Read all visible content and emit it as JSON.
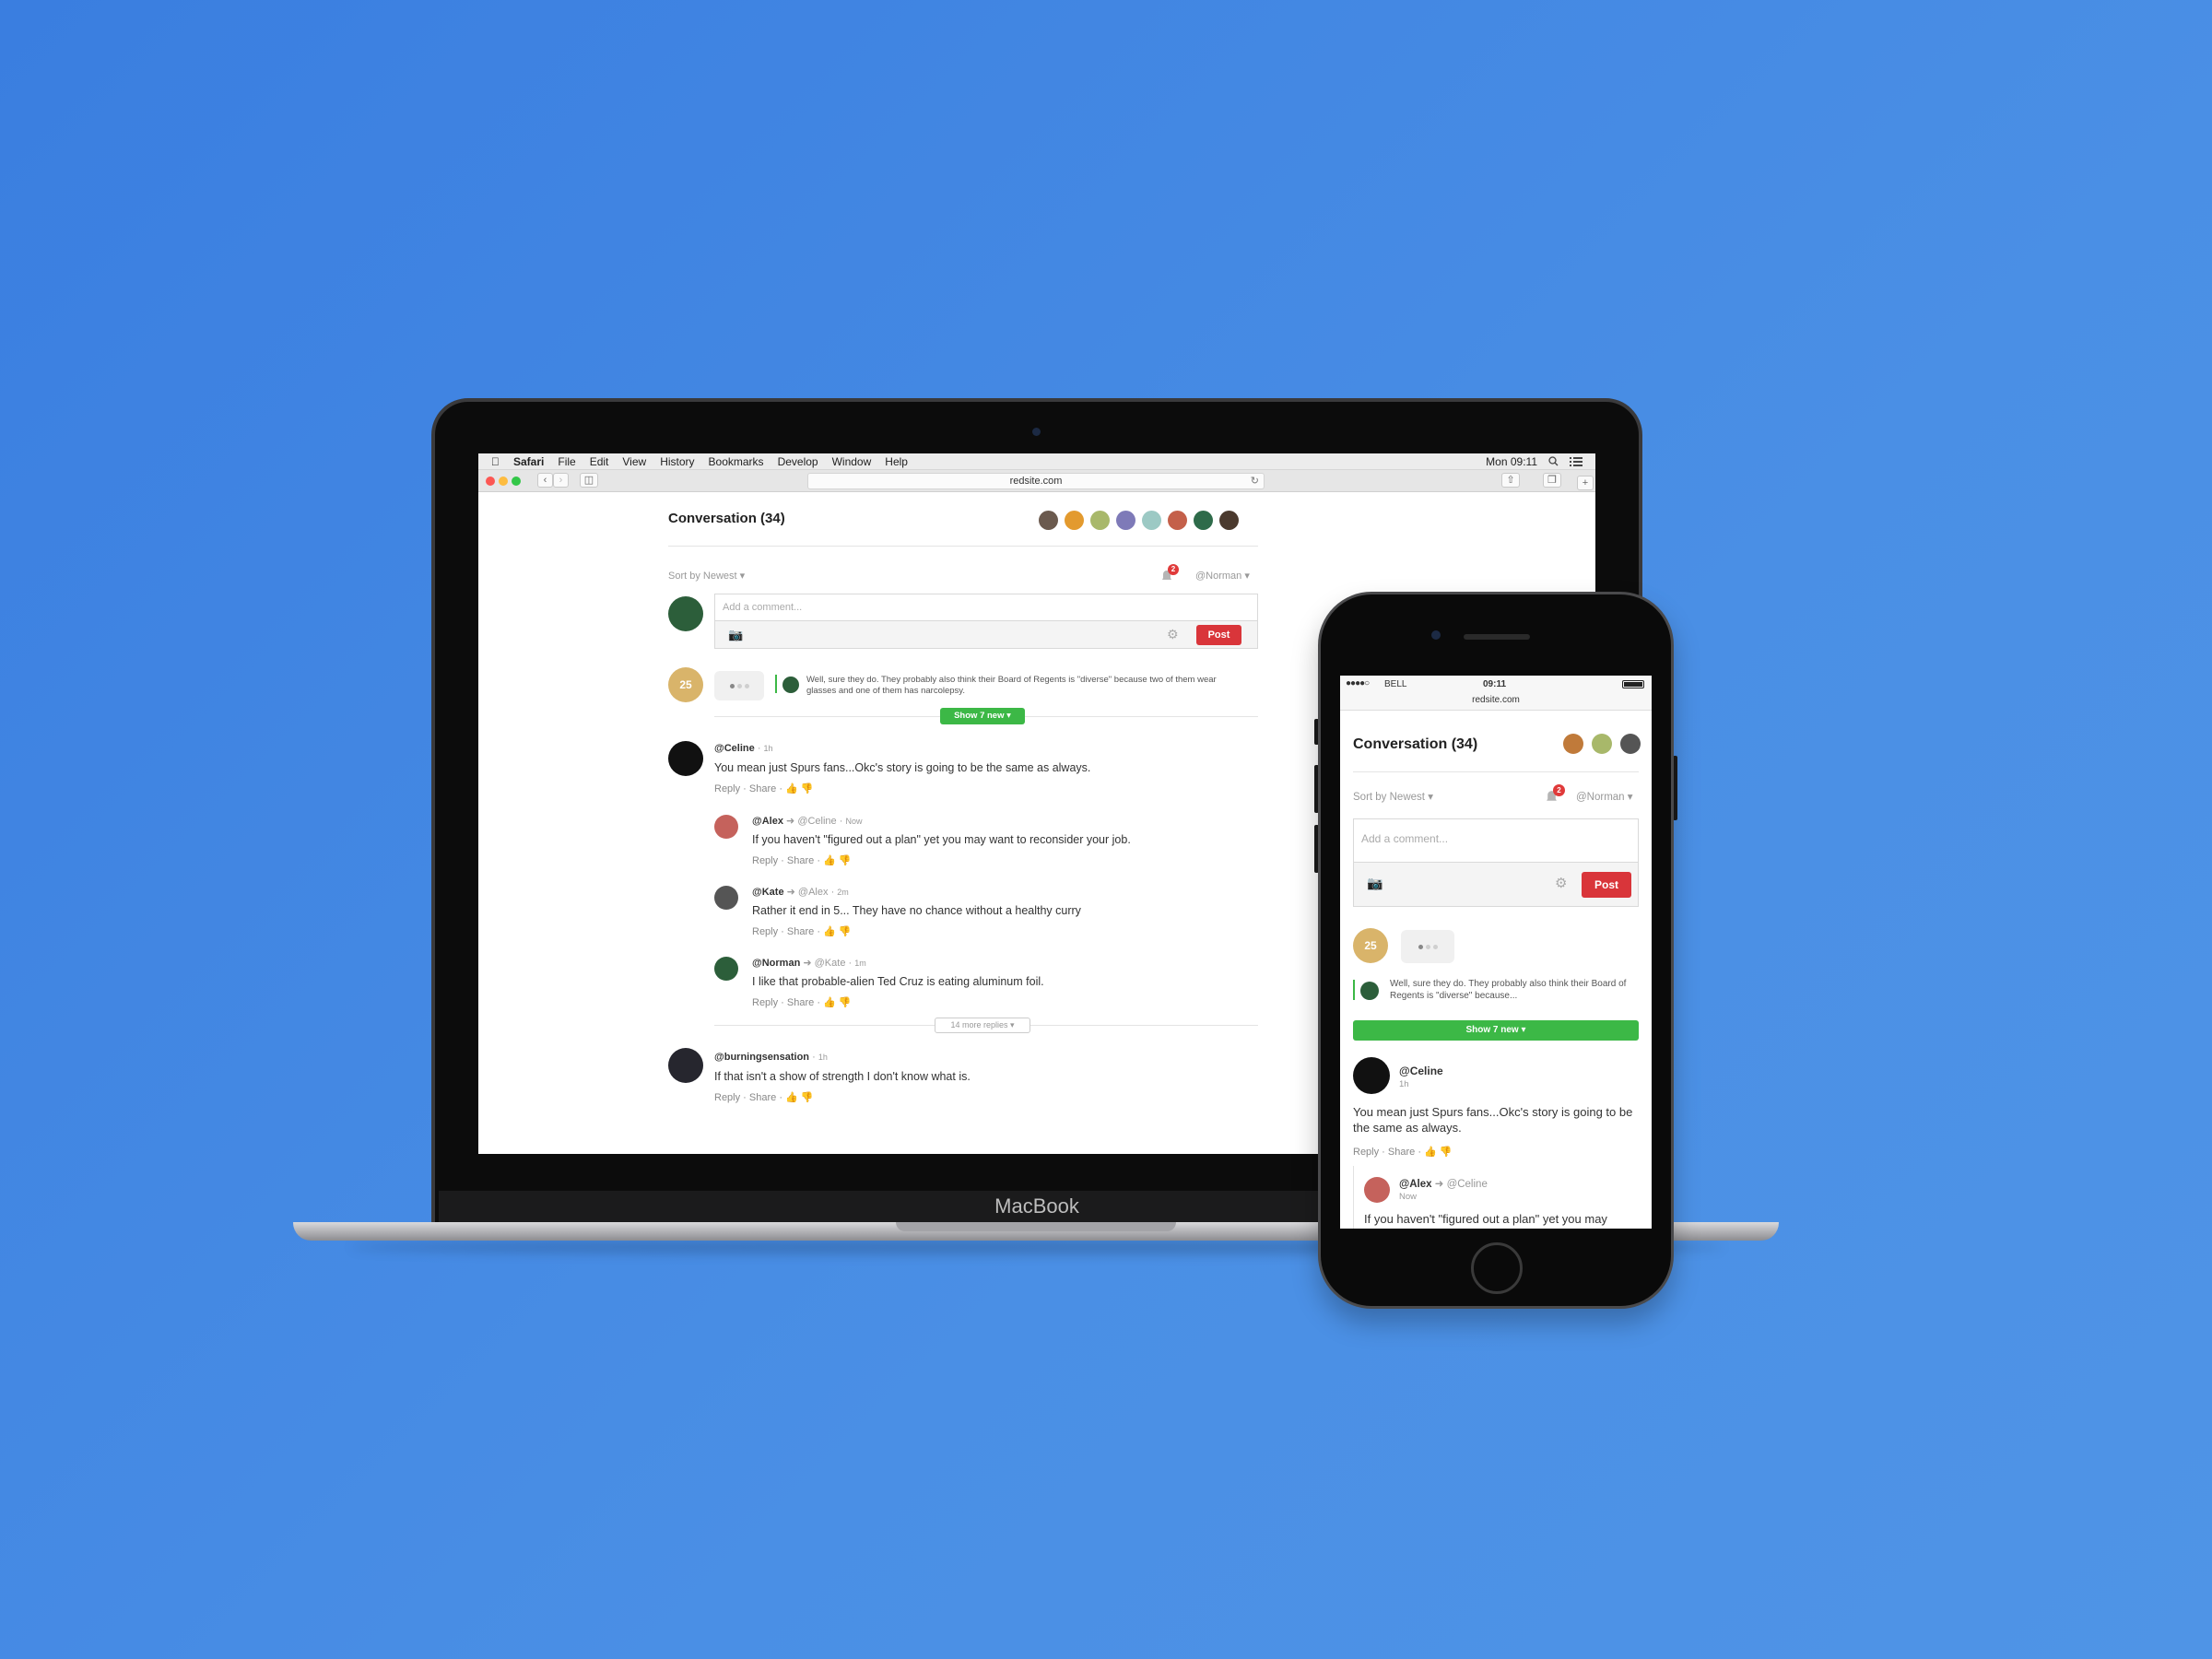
{
  "menubar": {
    "apple": "",
    "app": "Safari",
    "items": [
      "File",
      "Edit",
      "View",
      "History",
      "Bookmarks",
      "Develop",
      "Window",
      "Help"
    ],
    "clock": "Mon 09:11"
  },
  "browser": {
    "url": "redsite.com"
  },
  "conversation": {
    "title": "Conversation (34)",
    "sort": "Sort by Newest",
    "notif_count": "2",
    "user": "@Norman",
    "comment_placeholder": "Add a comment...",
    "post_label": "Post",
    "typing_count": "25",
    "quote": "Well, sure they do. They probably also think their Board of Regents is \"diverse\" because two of them wear glasses and one of them has narcolepsy.",
    "show_new": "Show 7 new",
    "more_replies": "14 more replies",
    "reply": "Reply",
    "share": "Share",
    "sep": "·",
    "comments": [
      {
        "user": "@Celine",
        "time": "1h",
        "text": "You mean just Spurs fans...Okc's story is going to be the same as always."
      },
      {
        "user": "@Alex",
        "to": "@Celine",
        "time": "Now",
        "text": "If you haven't \"figured out a plan\" yet you may want to reconsider your job."
      },
      {
        "user": "@Kate",
        "to": "@Alex",
        "time": "2m",
        "text": "Rather it end in 5... They have no chance without a healthy curry"
      },
      {
        "user": "@Norman",
        "to": "@Kate",
        "time": "1m",
        "text": "I like that probable-alien Ted Cruz is eating aluminum foil."
      },
      {
        "user": "@burningsensation",
        "time": "1h",
        "text": "If that isn't a show of strength I don't know what is."
      }
    ]
  },
  "laptop": {
    "brand": "MacBook"
  },
  "phone": {
    "carrier": "BELL",
    "signal": "●●●●○",
    "time": "09:11",
    "url": "redsite.com",
    "quote": "Well, sure they do. They probably also think their Board of Regents is \"diverse\" because...",
    "reply_partial": "If you haven't \"figured out a plan\" yet you may"
  },
  "colors": {
    "accent_red": "#d9353a",
    "accent_green": "#3cb846",
    "background": "#4188e2"
  }
}
